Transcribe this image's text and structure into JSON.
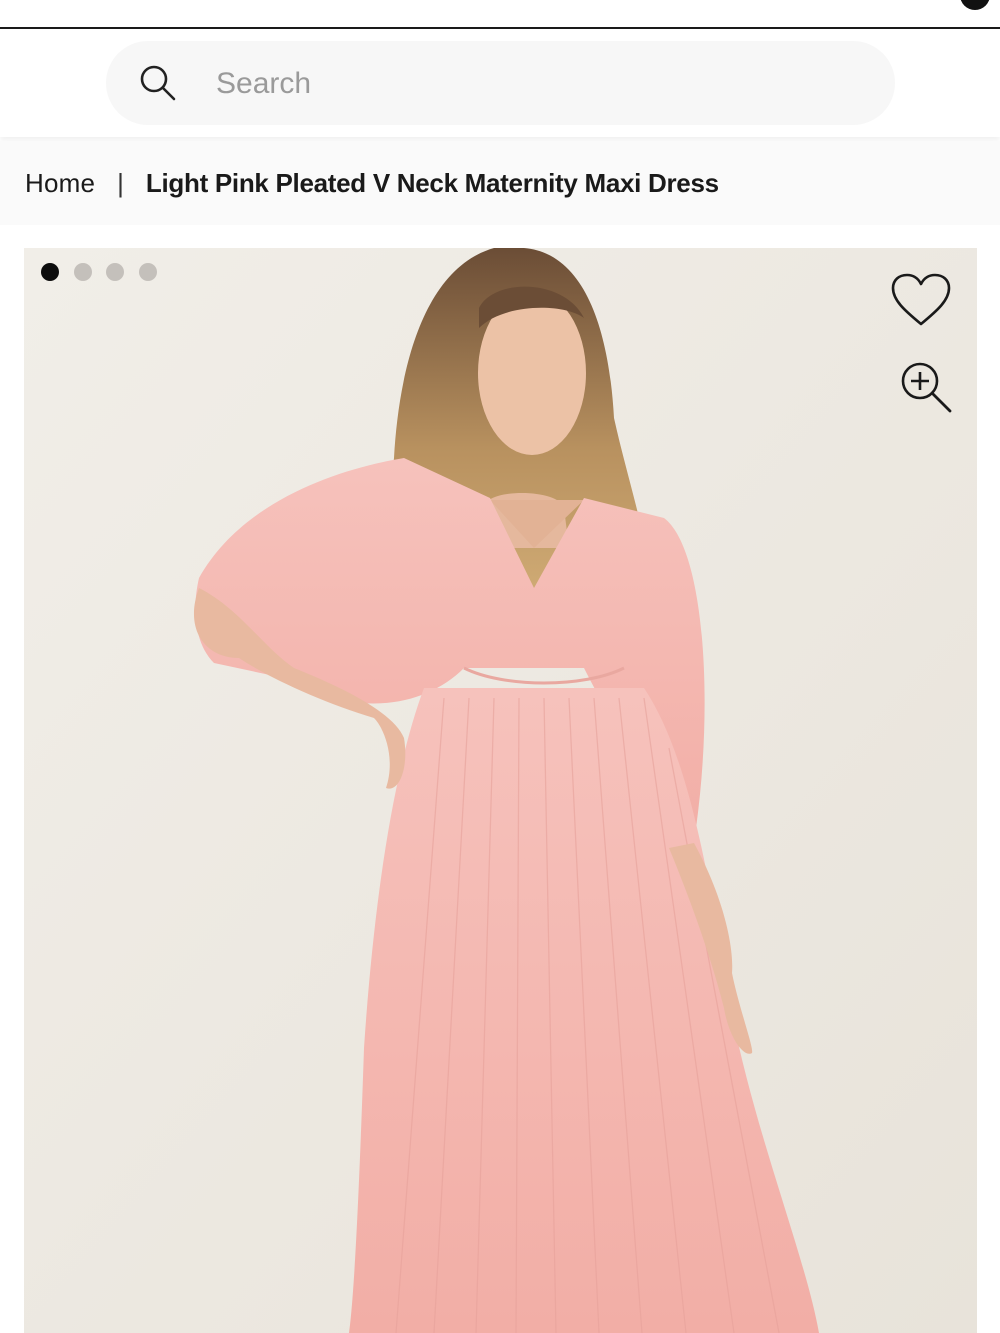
{
  "header": {
    "cart_icon": "cart-count-badge"
  },
  "search": {
    "icon": "search-icon",
    "placeholder": "Search",
    "value": ""
  },
  "breadcrumb": {
    "home_label": "Home",
    "separator": "|",
    "current_label": "Light Pink Pleated V Neck Maternity Maxi Dress"
  },
  "gallery": {
    "image_count": 4,
    "active_index": 0,
    "wishlist_icon": "heart-icon",
    "zoom_icon": "zoom-in-icon",
    "colors": {
      "background": "#efebe4",
      "dress": "#f4b9b3",
      "active_dot": "#0d0d0d",
      "inactive_dot": "#c4c0bb"
    }
  }
}
